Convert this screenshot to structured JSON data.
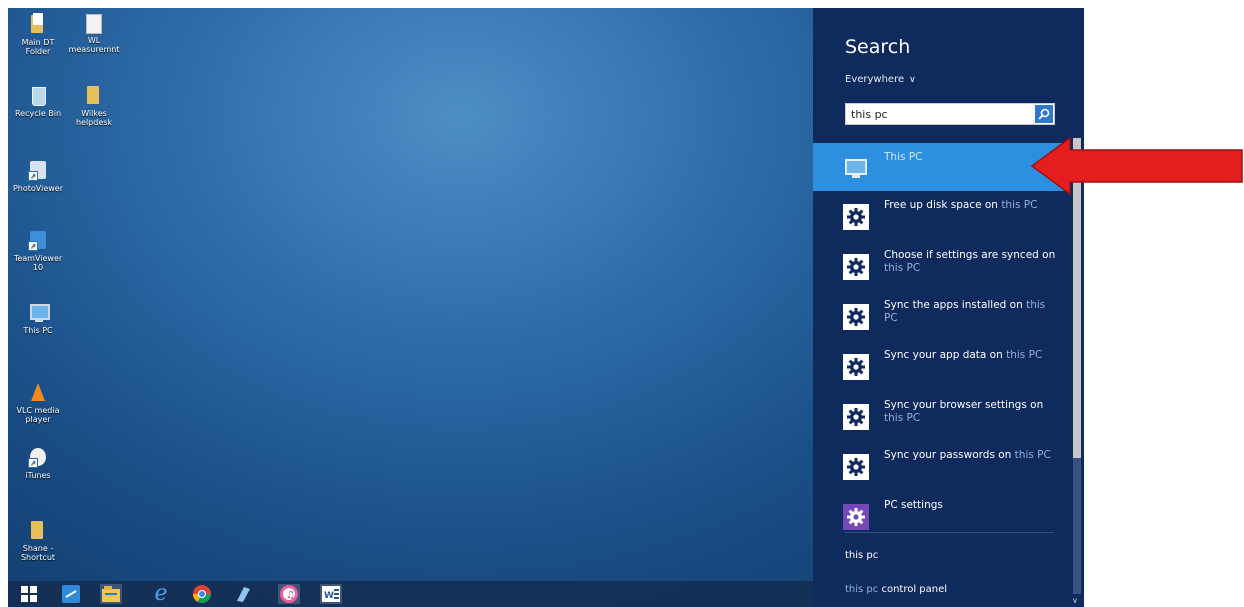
{
  "desktop": {
    "icons": [
      {
        "label": "Main DT Folder",
        "icon": "folder-icon"
      },
      {
        "label": "WL measuremnt",
        "icon": "document-icon"
      },
      {
        "label": "Recycle Bin",
        "icon": "recycle-bin-icon"
      },
      {
        "label": "Wilkes helpdesk",
        "icon": "folder-icon"
      },
      {
        "label": "PhotoViewer",
        "icon": "photoviewer-shortcut-icon"
      },
      {
        "label": "TeamViewer 10",
        "icon": "teamviewer-icon"
      },
      {
        "label": "This PC",
        "icon": "this-pc-icon"
      },
      {
        "label": "VLC media player",
        "icon": "vlc-icon"
      },
      {
        "label": "iTunes",
        "icon": "itunes-icon"
      },
      {
        "label": "Shane - Shortcut",
        "icon": "shortcut-folder-icon"
      }
    ]
  },
  "taskbar": {
    "items": [
      "start-icon",
      "teamviewer-icon",
      "file-explorer-icon",
      "internet-explorer-icon",
      "chrome-icon",
      "app-icon",
      "itunes-icon",
      "word-icon"
    ]
  },
  "search_charm": {
    "title": "Search",
    "scope": "Everywhere",
    "query": "this pc",
    "results": [
      {
        "pre": "This PC",
        "hl": "",
        "icon": "this-pc-icon",
        "selected": true
      },
      {
        "pre": "Free up disk space on ",
        "hl": "this PC",
        "icon": "gear-icon"
      },
      {
        "pre": "Choose if settings are synced on ",
        "hl": "this PC",
        "icon": "gear-icon"
      },
      {
        "pre": "Sync the apps installed on ",
        "hl": "this PC",
        "icon": "gear-icon"
      },
      {
        "pre": "Sync your app data on ",
        "hl": "this PC",
        "icon": "gear-icon"
      },
      {
        "pre": "Sync your browser settings on ",
        "hl": "this PC",
        "icon": "gear-icon"
      },
      {
        "pre": "Sync your passwords on ",
        "hl": "this PC",
        "icon": "gear-icon"
      },
      {
        "pre": "PC settings",
        "hl": "",
        "icon": "pc-settings-gear-icon"
      }
    ],
    "suggestions": [
      {
        "dim": "",
        "text": "this pc"
      },
      {
        "dim": "this pc ",
        "text": "control panel"
      }
    ]
  },
  "colors": {
    "charm_bg": "#0f2a5c",
    "selected_bg": "#2c8fe0",
    "highlight_text": "#8fb3dd",
    "arrow_red": "#e41e1e"
  }
}
